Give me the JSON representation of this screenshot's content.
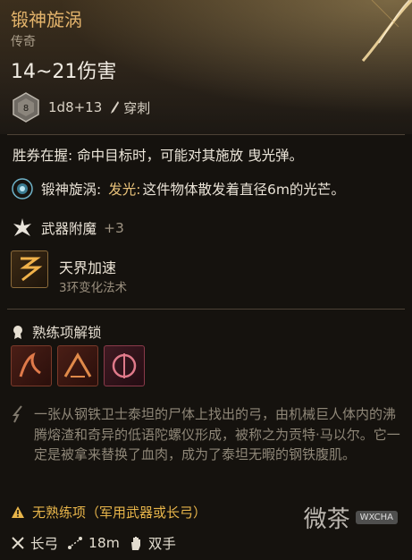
{
  "item": {
    "name": "锻神旋涡",
    "rarity": "传奇",
    "damage": "14~21伤害",
    "dice": "1d8+13",
    "dice_face": "8",
    "damage_type": "穿刺"
  },
  "effects": {
    "trait_line": "胜券在握: 命中目标时，可能对其施放 曳光弹。",
    "aura_label": "锻神旋涡:",
    "aura_name": "发光:",
    "aura_desc": "这件物体散发着直径6m的光芒。",
    "enchant_label": "武器附魔",
    "enchant_value": "+3",
    "spell_name": "天界加速",
    "spell_level": "3环变化法术"
  },
  "proficiency": {
    "title": "熟练项解锁"
  },
  "description": "一张从钢铁卫士泰坦的尸体上找出的弓，由机械巨人体内的沸腾熔渣和奇异的低语陀螺仪形成，被称之为贡特·马以尔。它一定是被拿来替换了血肉，成为了泰坦无暇的钢铁腹肌。",
  "warning": "无熟练项（军用武器或长弓）",
  "footer": {
    "weapon_type": "长弓",
    "range": "18m",
    "hands": "双手"
  },
  "watermark": {
    "text": "微茶",
    "badge": "WXCHA"
  },
  "colors": {
    "title_gold": "#e3b36b",
    "warning_amber": "#e8b54a",
    "desc_gray": "#8f8778"
  }
}
